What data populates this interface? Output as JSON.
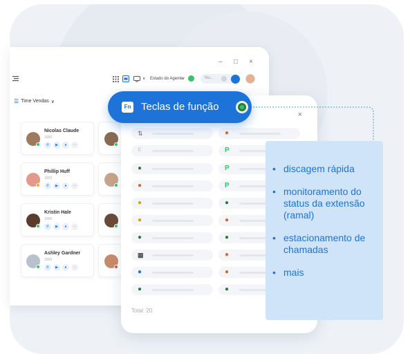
{
  "toolbar": {
    "minimize": "–",
    "maximize": "□",
    "close": "×",
    "agent_state_label": "Estado do Agente",
    "search_placeholder": "Nu..."
  },
  "team": {
    "label": "Time Vendas"
  },
  "contacts": [
    {
      "name": "Nicolas Claude",
      "ext": "1000",
      "status": "#34c46a"
    },
    {
      "name": "Phillip Huff",
      "ext": "1003",
      "status": "#f6a623"
    },
    {
      "name": "Kristin Hale",
      "ext": "1006",
      "status": "#34c46a"
    },
    {
      "name": "Ashley Gardner",
      "ext": "1009",
      "status": "#34c46a"
    }
  ],
  "tooltip": {
    "badge": "Fn",
    "title": "Teclas de função"
  },
  "panel": {
    "close": "×",
    "total": "Total: 20"
  },
  "features": [
    {
      "text": "discagem rápida"
    },
    {
      "text": "monitoramento do status da extensão (ramal)"
    },
    {
      "text": "estacionamento de chamadas"
    },
    {
      "text": "mais"
    }
  ],
  "colors": {
    "primary": "#1e73d8",
    "feature_bg": "#cfe4f8",
    "online": "#34c46a",
    "park": "#34c46a"
  }
}
